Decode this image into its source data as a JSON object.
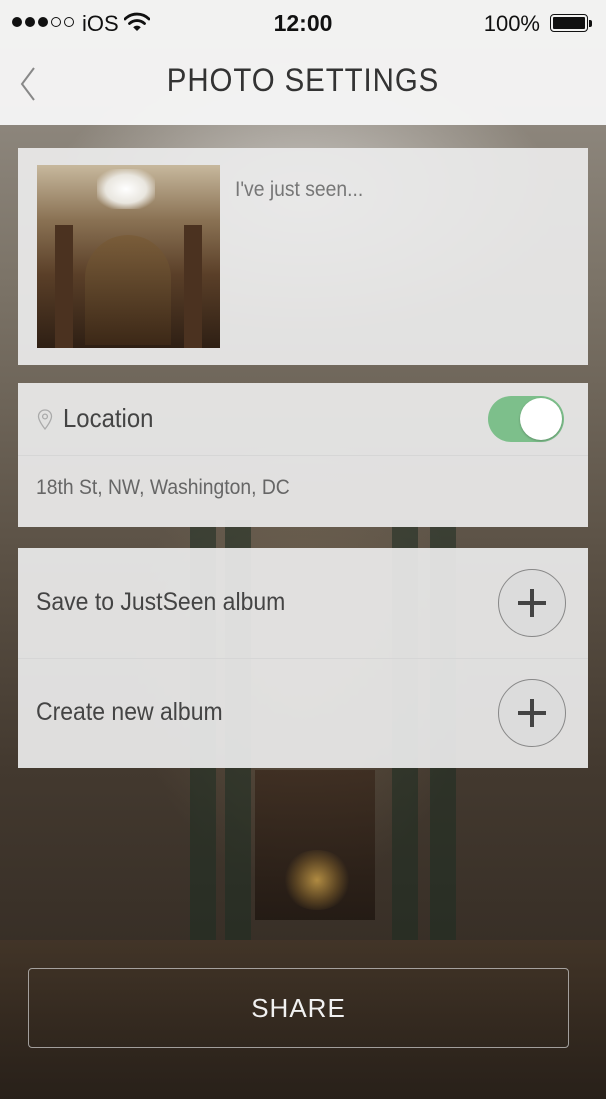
{
  "status_bar": {
    "carrier": "iOS",
    "time": "12:00",
    "battery": "100%",
    "signal_bars": 3,
    "signal_total": 5
  },
  "nav": {
    "title": "PHOTO SETTINGS",
    "back_icon": "chevron-left-icon"
  },
  "photo": {
    "caption_placeholder": "I've just seen..."
  },
  "location": {
    "label": "Location",
    "enabled": true,
    "address": "18th St, NW, Washington, DC",
    "icon": "location-pin-icon",
    "toggle_color": "#7dbf8b"
  },
  "albums": {
    "save_label": "Save to JustSeen album",
    "create_label": "Create new album",
    "icon": "plus-icon"
  },
  "share": {
    "label": "SHARE"
  }
}
